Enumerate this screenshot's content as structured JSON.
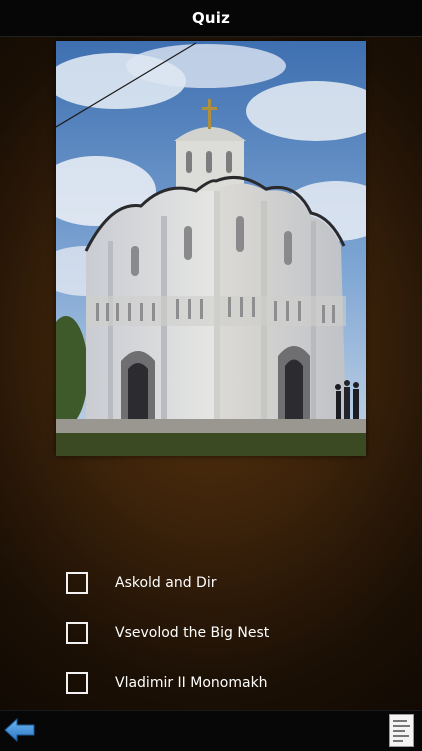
{
  "header": {
    "title": "Quiz"
  },
  "photo": {
    "subject": "cathedral-photo"
  },
  "options": [
    {
      "label": "Askold and Dir",
      "checked": false
    },
    {
      "label": "Vsevolod the Big Nest",
      "checked": false
    },
    {
      "label": "Vladimir II Monomakh",
      "checked": false
    }
  ],
  "footer": {
    "back_icon": "back-arrow-icon",
    "notes_icon": "notes-icon"
  },
  "colors": {
    "accent": "#3a8fd8",
    "header_bg": "#060606"
  }
}
